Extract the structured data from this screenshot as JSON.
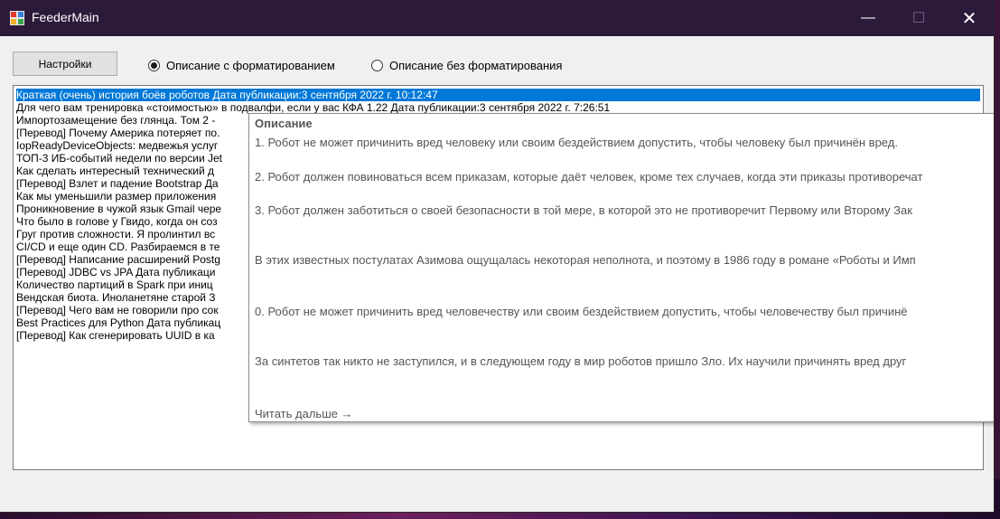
{
  "window": {
    "title": "FeederMain",
    "minimize_glyph": "—",
    "maximize_glyph": "☐",
    "close_glyph": "✕"
  },
  "toolbar": {
    "settings_label": "Настройки",
    "radio_formatted": {
      "label": "Описание с форматированием",
      "checked": true
    },
    "radio_plain": {
      "label": "Описание без форматирования",
      "checked": false
    }
  },
  "feed_list": {
    "items": [
      "Краткая (очень) история боёв роботов Дата публикации:3 сентября 2022 г. 10:12:47",
      "Для чего вам тренировка «стоимостью» в подвалфи, если у вас КФА 1.22 Дата публикации:3 сентября 2022 г. 7:26:51",
      "Импортозамещение без глянца. Том 2 -",
      "[Перевод] Почему Америка потеряет по.",
      "IopReadyDeviceObjects: медвежья услуг",
      "ТОП-3 ИБ-событий недели по версии Jet",
      "Как сделать интересный технический д",
      "[Перевод] Взлет и падение Bootstrap Да",
      "Как мы уменьшили размер приложения",
      "Проникновение в чужой язык Gmail чере",
      "Что было в голове у Гвидо, когда он соз",
      "Груг против сложности. Я пролинтил вс",
      "CI/CD и еще один CD. Разбираемся в те",
      "[Перевод] Написание расширений Postg",
      "[Перевод] JDBC vs JPA Дата публикаци",
      "Количество партиций в Spark при иниц",
      "Вендская биота. Иноланетяне старой З",
      "[Перевод] Чего вам не говорили про сок",
      "Best Practices для Python Дата публикац",
      "[Перевод] Как сгенерировать UUID в ка"
    ]
  },
  "tooltip": {
    "title": "Описание",
    "lines": [
      "1. Робот не может причинить вред человеку или своим бездействием допустить, чтобы человеку был причинён вред.",
      "2. Робот должен повиноваться всем приказам, которые даёт человек, кроме тех случаев, когда эти приказы противоречат",
      "3. Робот должен заботиться о своей безопасности в той мере, в которой это не противоречит Первому или Второму Зак",
      "В этих известных постулатах Азимова ощущалась некоторая неполнота, и поэтому в 1986 году в романе «Роботы и Имп",
      "0. Робот не может причинить вред человечеству или своим бездействием допустить, чтобы человечеству был причинё",
      "За синтетов так никто не заступился, и в следующем году в мир роботов пришло Зло. Их научили причинять вред друг"
    ],
    "read_more": "Читать дальше →"
  },
  "colors": {
    "titlebar": "#2b1a3a",
    "selection": "#0078d7",
    "window_bg": "#f0f0f0"
  }
}
